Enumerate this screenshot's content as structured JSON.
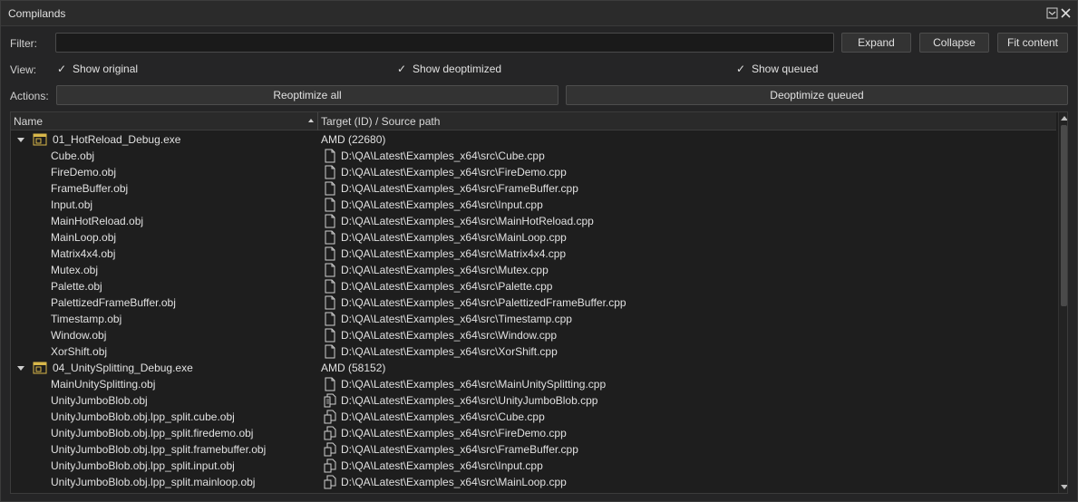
{
  "window": {
    "title": "Compilands",
    "icons": [
      "minimize-icon",
      "close-icon"
    ]
  },
  "filter": {
    "label": "Filter:",
    "value": "",
    "placeholder": ""
  },
  "buttons": {
    "expand": "Expand",
    "collapse": "Collapse",
    "fit_content": "Fit content"
  },
  "view": {
    "label": "View:",
    "options": [
      {
        "label": "Show original",
        "checked": true
      },
      {
        "label": "Show deoptimized",
        "checked": true
      },
      {
        "label": "Show queued",
        "checked": true
      }
    ]
  },
  "actions": {
    "label": "Actions:",
    "reoptimize_all": "Reoptimize all",
    "deoptimize_queued": "Deoptimize queued"
  },
  "table": {
    "columns": [
      "Name",
      "Target (ID) / Source path"
    ],
    "sort": "ascending",
    "rows": [
      {
        "type": "exe",
        "name": "01_HotReload_Debug.exe",
        "target": "AMD (22680)",
        "expanded": true
      },
      {
        "type": "obj",
        "name": "Cube.obj",
        "path": "D:\\QA\\Latest\\Examples_x64\\src\\Cube.cpp",
        "icon": "file-icon"
      },
      {
        "type": "obj",
        "name": "FireDemo.obj",
        "path": "D:\\QA\\Latest\\Examples_x64\\src\\FireDemo.cpp",
        "icon": "file-icon"
      },
      {
        "type": "obj",
        "name": "FrameBuffer.obj",
        "path": "D:\\QA\\Latest\\Examples_x64\\src\\FrameBuffer.cpp",
        "icon": "file-icon"
      },
      {
        "type": "obj",
        "name": "Input.obj",
        "path": "D:\\QA\\Latest\\Examples_x64\\src\\Input.cpp",
        "icon": "file-icon"
      },
      {
        "type": "obj",
        "name": "MainHotReload.obj",
        "path": "D:\\QA\\Latest\\Examples_x64\\src\\MainHotReload.cpp",
        "icon": "file-icon"
      },
      {
        "type": "obj",
        "name": "MainLoop.obj",
        "path": "D:\\QA\\Latest\\Examples_x64\\src\\MainLoop.cpp",
        "icon": "file-icon"
      },
      {
        "type": "obj",
        "name": "Matrix4x4.obj",
        "path": "D:\\QA\\Latest\\Examples_x64\\src\\Matrix4x4.cpp",
        "icon": "file-icon"
      },
      {
        "type": "obj",
        "name": "Mutex.obj",
        "path": "D:\\QA\\Latest\\Examples_x64\\src\\Mutex.cpp",
        "icon": "file-icon"
      },
      {
        "type": "obj",
        "name": "Palette.obj",
        "path": "D:\\QA\\Latest\\Examples_x64\\src\\Palette.cpp",
        "icon": "file-icon"
      },
      {
        "type": "obj",
        "name": "PalettizedFrameBuffer.obj",
        "path": "D:\\QA\\Latest\\Examples_x64\\src\\PalettizedFrameBuffer.cpp",
        "icon": "file-icon"
      },
      {
        "type": "obj",
        "name": "Timestamp.obj",
        "path": "D:\\QA\\Latest\\Examples_x64\\src\\Timestamp.cpp",
        "icon": "file-icon"
      },
      {
        "type": "obj",
        "name": "Window.obj",
        "path": "D:\\QA\\Latest\\Examples_x64\\src\\Window.cpp",
        "icon": "file-icon"
      },
      {
        "type": "obj",
        "name": "XorShift.obj",
        "path": "D:\\QA\\Latest\\Examples_x64\\src\\XorShift.cpp",
        "icon": "file-icon"
      },
      {
        "type": "exe",
        "name": "04_UnitySplitting_Debug.exe",
        "target": "AMD (58152)",
        "expanded": true
      },
      {
        "type": "obj",
        "name": "MainUnitySplitting.obj",
        "path": "D:\\QA\\Latest\\Examples_x64\\src\\MainUnitySplitting.cpp",
        "icon": "file-icon"
      },
      {
        "type": "obj",
        "name": "UnityJumboBlob.obj",
        "path": "D:\\QA\\Latest\\Examples_x64\\src\\UnityJumboBlob.cpp",
        "icon": "unity-file-icon"
      },
      {
        "type": "obj",
        "name": "UnityJumboBlob.obj.lpp_split.cube.obj",
        "path": "D:\\QA\\Latest\\Examples_x64\\src\\Cube.cpp",
        "icon": "split-file-icon"
      },
      {
        "type": "obj",
        "name": "UnityJumboBlob.obj.lpp_split.firedemo.obj",
        "path": "D:\\QA\\Latest\\Examples_x64\\src\\FireDemo.cpp",
        "icon": "split-file-icon"
      },
      {
        "type": "obj",
        "name": "UnityJumboBlob.obj.lpp_split.framebuffer.obj",
        "path": "D:\\QA\\Latest\\Examples_x64\\src\\FrameBuffer.cpp",
        "icon": "split-file-icon"
      },
      {
        "type": "obj",
        "name": "UnityJumboBlob.obj.lpp_split.input.obj",
        "path": "D:\\QA\\Latest\\Examples_x64\\src\\Input.cpp",
        "icon": "split-file-icon"
      },
      {
        "type": "obj",
        "name": "UnityJumboBlob.obj.lpp_split.mainloop.obj",
        "path": "D:\\QA\\Latest\\Examples_x64\\src\\MainLoop.cpp",
        "icon": "split-file-icon"
      }
    ]
  }
}
